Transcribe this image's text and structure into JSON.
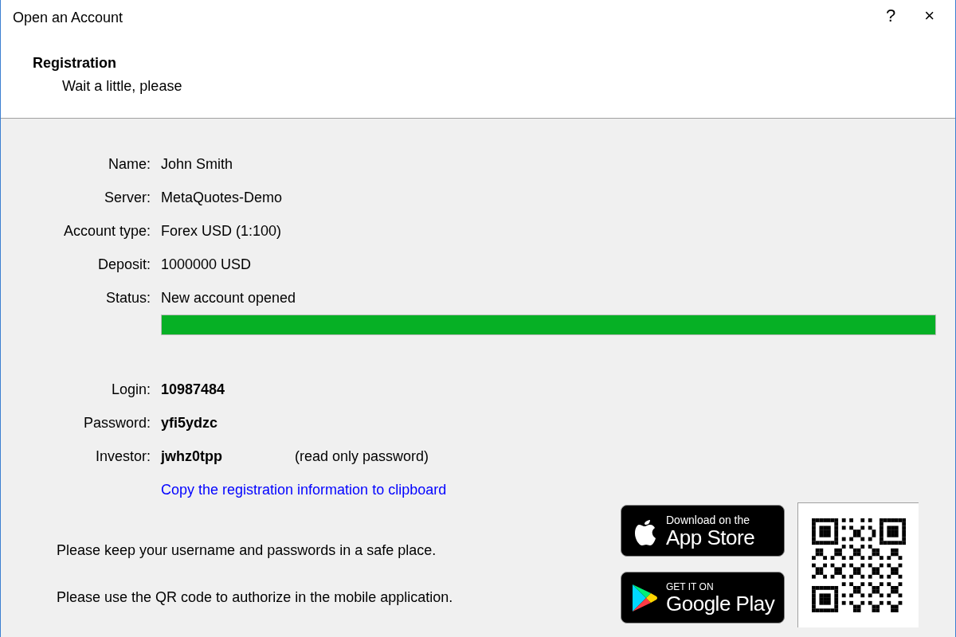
{
  "window": {
    "title": "Open an Account",
    "buttons": [
      "?",
      "×"
    ]
  },
  "header": {
    "title": "Registration",
    "subtitle": "Wait a little, please"
  },
  "fields": [
    {
      "label": "Name:",
      "value": "John Smith"
    },
    {
      "label": "Server:",
      "value": "MetaQuotes-Demo"
    },
    {
      "label": "Account type:",
      "value": "Forex USD (1:100)"
    },
    {
      "label": "Deposit:",
      "value": "1000000 USD"
    },
    {
      "label": "Status:",
      "value": "New account opened"
    }
  ],
  "progress": {
    "level": 1
  },
  "credentials": [
    {
      "label": "Login:",
      "value": "10987484"
    },
    {
      "label": "Password:",
      "value": "yfi5ydzc"
    },
    {
      "label": "Investor:",
      "value": "jwhz0tpp",
      "note": "(read only password)"
    }
  ],
  "copy_link": "Copy the registration information to clipboard",
  "notes": [
    "Please keep your username and passwords in a safe place.",
    "Please use the QR code to authorize in the mobile application."
  ],
  "store_badges": [
    {
      "kind": "apple",
      "top": "Download on the",
      "bottom": "App Store"
    },
    {
      "kind": "google",
      "top": "GET IT ON",
      "bottom": "Google Play"
    }
  ]
}
